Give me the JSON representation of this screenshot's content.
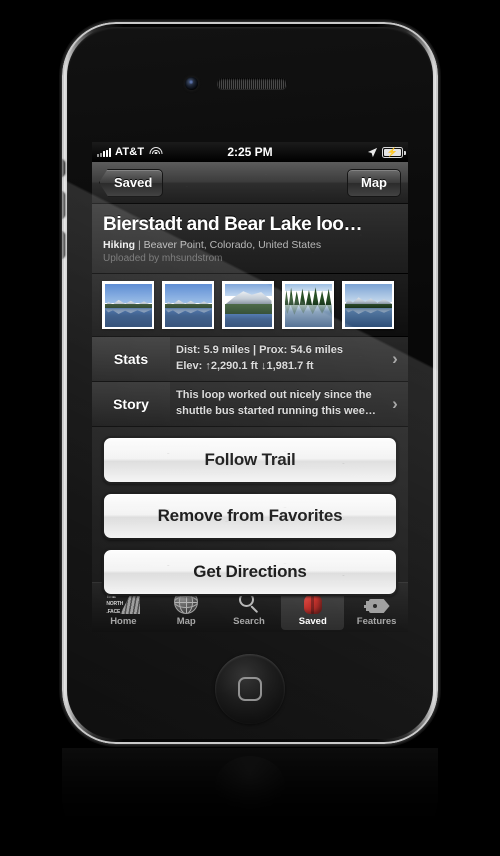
{
  "status_bar": {
    "carrier": "AT&T",
    "time": "2:25 PM",
    "signal_icon": "signal-bars-icon",
    "wifi_icon": "wifi-icon",
    "location_icon": "location-arrow-icon",
    "battery_icon": "battery-charging-icon"
  },
  "nav_bar": {
    "back_label": "Saved",
    "right_label": "Map"
  },
  "header": {
    "title": "Bierstadt and Bear Lake loo…",
    "activity": "Hiking",
    "separator": "|",
    "location": "Beaver Point, Colorado, United States",
    "uploader": "Uploaded by mhsundstrom"
  },
  "photos": [
    {
      "name": "photo-thumbnail-1",
      "alt": "Mountain range reflected in lake"
    },
    {
      "name": "photo-thumbnail-2",
      "alt": "Mountain range reflected in lake"
    },
    {
      "name": "photo-thumbnail-3",
      "alt": "Snowy peak above forest"
    },
    {
      "name": "photo-thumbnail-4",
      "alt": "Pine forest reflected in water"
    },
    {
      "name": "photo-thumbnail-5",
      "alt": "Snowy peaks above lake"
    }
  ],
  "info_rows": [
    {
      "label": "Stats",
      "line1": "Dist: 5.9 miles  |  Prox: 54.6 miles",
      "line2": "Elev: ↑2,290.1 ft  ↓1,981.7 ft",
      "chevron": "›"
    },
    {
      "label": "Story",
      "line1": "This loop worked out nicely since the",
      "line2": "shuttle bus started running this wee…",
      "chevron": "›"
    }
  ],
  "actions": [
    {
      "label": "Follow Trail"
    },
    {
      "label": "Remove from Favorites"
    },
    {
      "label": "Get Directions"
    }
  ],
  "tab_bar": [
    {
      "label": "Home",
      "icon": "north-face-logo-icon",
      "active": false
    },
    {
      "label": "Map",
      "icon": "globe-icon",
      "active": false
    },
    {
      "label": "Search",
      "icon": "magnifier-icon",
      "active": false
    },
    {
      "label": "Saved",
      "icon": "backpack-icon",
      "active": true
    },
    {
      "label": "Features",
      "icon": "tag-icon",
      "active": false
    }
  ],
  "brand": {
    "logo_line1": "THE",
    "logo_line2": "NORTH",
    "logo_line3": ".FACE"
  },
  "colors": {
    "accent_red": "#c02620",
    "screen_bg": "#000000",
    "button_face": "#f2f2f2"
  }
}
